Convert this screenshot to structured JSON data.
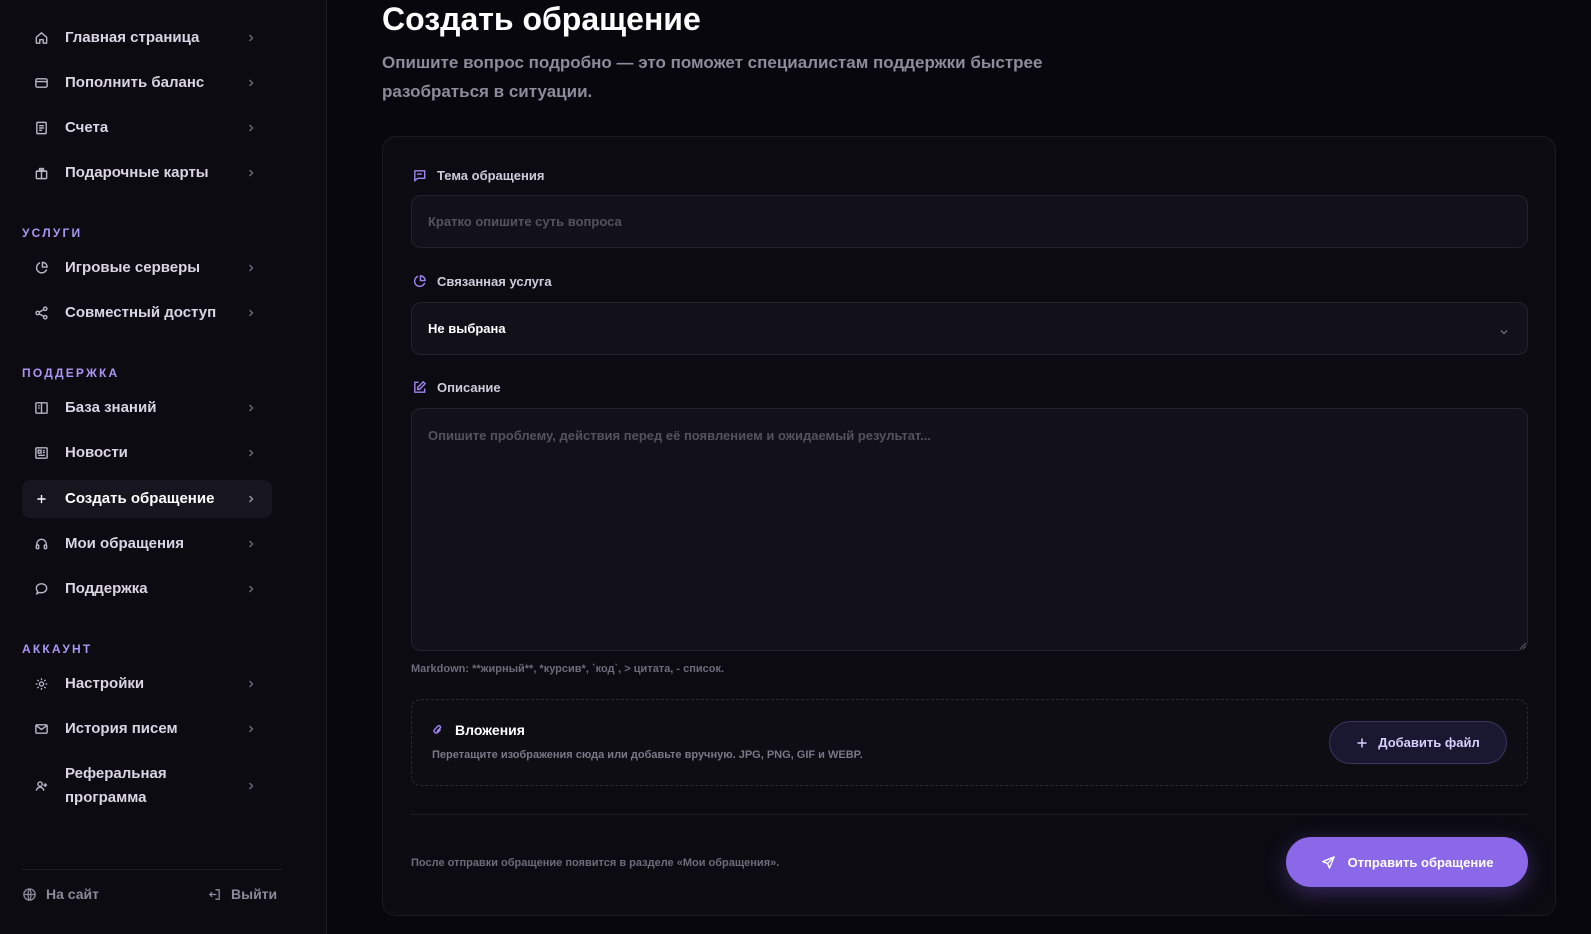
{
  "colors": {
    "accent": "#8a68e8",
    "section_title": "#a996f2",
    "background": "#08070d",
    "sidebar": "#0c0b12"
  },
  "sidebar": {
    "top_items": [
      {
        "label": "Главная страница",
        "icon": "home-icon"
      },
      {
        "label": "Пополнить баланс",
        "icon": "wallet-icon"
      },
      {
        "label": "Счета",
        "icon": "invoice-icon"
      },
      {
        "label": "Подарочные карты",
        "icon": "gift-icon"
      }
    ],
    "sections": [
      {
        "title": "УСЛУГИ",
        "items": [
          {
            "label": "Игровые серверы",
            "icon": "pie-chart-icon"
          },
          {
            "label": "Совместный доступ",
            "icon": "share-icon"
          }
        ]
      },
      {
        "title": "ПОДДЕРЖКА",
        "items": [
          {
            "label": "База знаний",
            "icon": "book-icon"
          },
          {
            "label": "Новости",
            "icon": "newspaper-icon"
          },
          {
            "label": "Создать обращение",
            "icon": "plus-icon",
            "active": true
          },
          {
            "label": "Мои обращения",
            "icon": "headset-icon"
          },
          {
            "label": "Поддержка",
            "icon": "chat-bubble-icon"
          }
        ]
      },
      {
        "title": "АККАУНТ",
        "items": [
          {
            "label": "Настройки",
            "icon": "gear-icon"
          },
          {
            "label": "История писем",
            "icon": "mail-icon"
          },
          {
            "label": "Реферальная программа",
            "icon": "user-plus-icon"
          }
        ]
      }
    ],
    "footer": {
      "site_link": "На сайт",
      "logout": "Выйти"
    }
  },
  "page": {
    "title": "Создать обращение",
    "subtitle": "Опишите вопрос подробно — это поможет специалистам поддержки быстрее разобраться в ситуации."
  },
  "form": {
    "subject": {
      "label": "Тема обращения",
      "placeholder": "Кратко опишите суть вопроса",
      "value": ""
    },
    "service": {
      "label": "Связанная услуга",
      "selected": "Не выбрана"
    },
    "description": {
      "label": "Описание",
      "placeholder": "Опишите проблему, действия перед её появлением и ожидаемый результат...",
      "value": "",
      "markdown_hint": "Markdown: **жирный**, *курсив*, `код`, > цитата, - список."
    },
    "attachments": {
      "title": "Вложения",
      "description": "Перетащите изображения сюда или добавьте вручную. JPG, PNG, GIF и WEBP.",
      "add_button": "Добавить файл"
    },
    "footer_note": "После отправки обращение появится в разделе «Мои обращения».",
    "submit_button": "Отправить обращение"
  }
}
